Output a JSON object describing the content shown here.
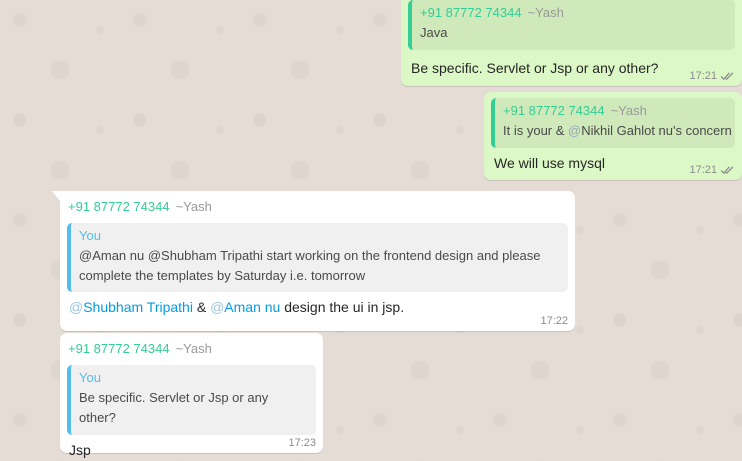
{
  "messages": [
    {
      "quote_author": "+91 87772 74344",
      "quote_push": "~Yash",
      "quote_text": "Java",
      "text": "Be specific. Servlet or Jsp or any other?",
      "time": "17:21"
    },
    {
      "quote_author": "+91 87772 74344",
      "quote_push": "~Yash",
      "quote_text_pre": "It is your & ",
      "quote_at": "@",
      "quote_mention": "Nikhil Gahlot nu's concern",
      "text": "We will use mysql",
      "time": "17:21"
    },
    {
      "sender": "+91 87772 74344",
      "push": "~Yash",
      "quote_author": "You",
      "quote_text": "@Aman nu @Shubham Tripathi start working on the frontend design and please complete the templates by Saturday i.e. tomorrow",
      "mention1_at": "@",
      "mention1": "Shubham Tripathi",
      "amp": " & ",
      "mention2_at": "@",
      "mention2": "Aman nu",
      "text_rest": " design the ui in jsp.",
      "time": "17:22"
    },
    {
      "sender": "+91 87772 74344",
      "push": "~Yash",
      "quote_author": "You",
      "quote_text": "Be specific. Servlet or Jsp or any other?",
      "text": "Jsp",
      "time": "17:23"
    }
  ],
  "colors": {
    "outgoing": "#dcf8c6",
    "incoming": "#ffffff",
    "sender": "#35cd96",
    "mention": "#039be5",
    "background": "#e5ddd5"
  },
  "icons": {
    "read_receipt": "double-check-icon"
  }
}
